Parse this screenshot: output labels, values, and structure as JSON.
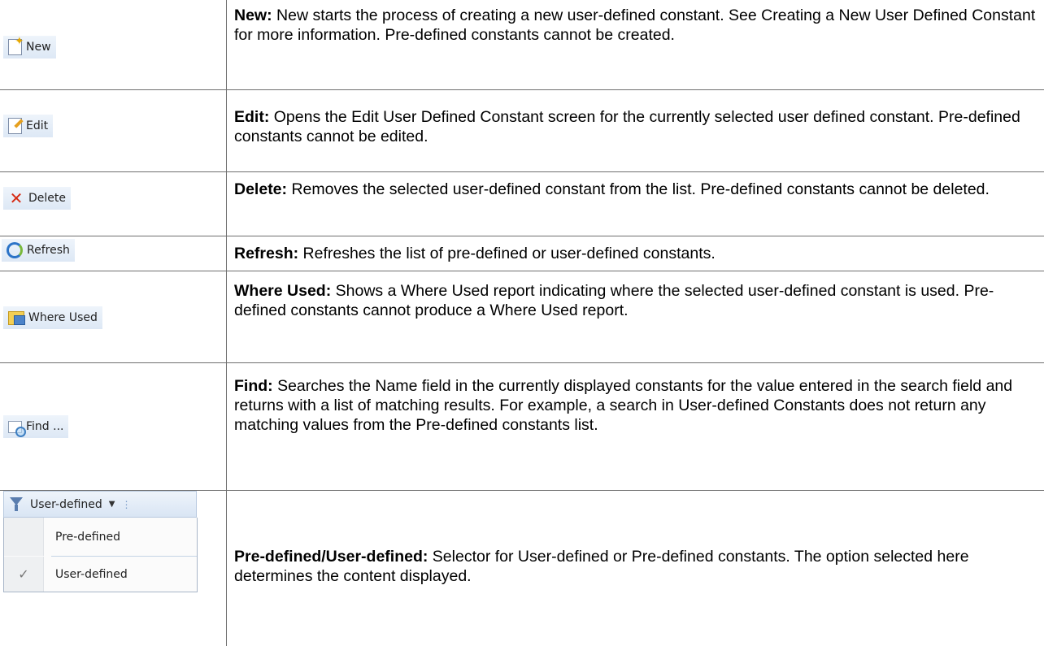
{
  "rows": [
    {
      "button_label": "New",
      "icon": "new-document-icon",
      "term": "New:",
      "text": " New starts the process of creating a new user-defined constant. See Creating a New User Defined Constant for more information. Pre-defined constants cannot be created."
    },
    {
      "button_label": "Edit",
      "icon": "edit-pencil-icon",
      "term": "Edit:",
      "text": " Opens the Edit User Defined Constant screen for the currently selected user defined constant. Pre-defined constants cannot be edited."
    },
    {
      "button_label": "Delete",
      "icon": "delete-x-icon",
      "term": "Delete:",
      "text": " Removes the selected user-defined constant from the list. Pre-defined constants cannot be deleted."
    },
    {
      "button_label": "Refresh",
      "icon": "refresh-icon",
      "term": "Refresh:",
      "text": " Refreshes the list of pre-defined or user-defined constants."
    },
    {
      "button_label": "Where Used",
      "icon": "where-used-icon",
      "term": "Where Used:",
      "text": " Shows a Where Used report indicating where the selected user-defined constant is used. Pre-defined constants cannot produce a Where Used report."
    },
    {
      "button_label": "Find ...",
      "icon": "find-icon",
      "term": "Find:",
      "text": " Searches the Name field in the currently displayed constants for the value entered in the search field and returns with a list of matching results. For example, a search in User-defined Constants does not return any matching values from the Pre-defined constants list."
    },
    {
      "term": "Pre-defined/User-defined:",
      "text": " Selector for User-defined or Pre-defined constants. The option selected here determines the content displayed."
    }
  ],
  "selector": {
    "selected_label": "User-defined",
    "options": [
      {
        "label": "Pre-defined",
        "checked": false
      },
      {
        "label": "User-defined",
        "checked": true
      }
    ]
  },
  "colors": {
    "border": "#6f6f6f",
    "button_bg": "#dde8f5"
  }
}
